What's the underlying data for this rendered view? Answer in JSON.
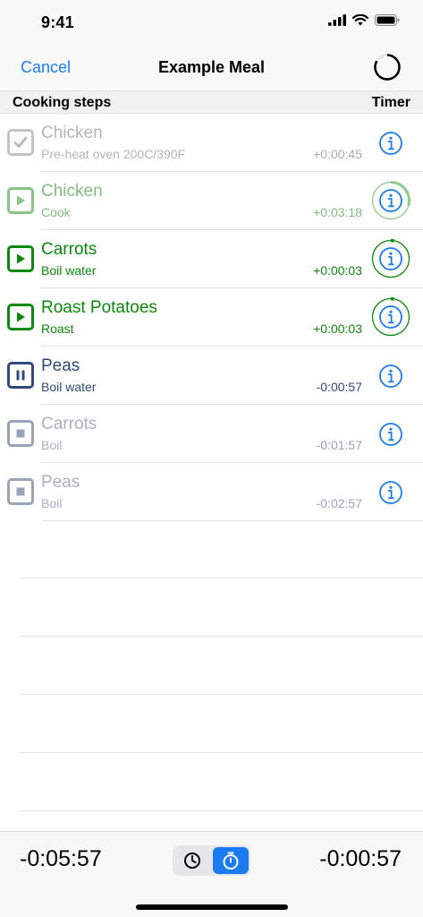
{
  "status_bar": {
    "time": "9:41"
  },
  "nav": {
    "cancel_label": "Cancel",
    "title": "Example Meal"
  },
  "section": {
    "left_label": "Cooking steps",
    "right_label": "Timer"
  },
  "steps": [
    {
      "title": "Chicken",
      "subtitle": "Pre-heat oven 200C/390F",
      "time": "+0:00:45",
      "state": "done"
    },
    {
      "title": "Chicken",
      "subtitle": "Cook",
      "time": "+0:03:18",
      "state": "running-faded"
    },
    {
      "title": "Carrots",
      "subtitle": "Boil water",
      "time": "+0:00:03",
      "state": "running"
    },
    {
      "title": "Roast Potatoes",
      "subtitle": "Roast",
      "time": "+0:00:03",
      "state": "running"
    },
    {
      "title": "Peas",
      "subtitle": "Boil water",
      "time": "-0:00:57",
      "state": "paused"
    },
    {
      "title": "Carrots",
      "subtitle": "Boil",
      "time": "-0:01:57",
      "state": "stopped"
    },
    {
      "title": "Peas",
      "subtitle": "Boil",
      "time": "-0:02:57",
      "state": "stopped"
    }
  ],
  "toolbar": {
    "total_left": "-0:05:57",
    "total_right": "-0:00:57",
    "modes": [
      "clock-icon",
      "stopwatch-icon"
    ],
    "selected_mode": "stopwatch-icon"
  },
  "colors": {
    "accent": "#1a7cf0",
    "green": "#0a8a0a",
    "green_faded": "#7dbf7d",
    "gray": "#b0b0b0",
    "navy": "#2d4a7a",
    "slate": "#97a3b8"
  }
}
